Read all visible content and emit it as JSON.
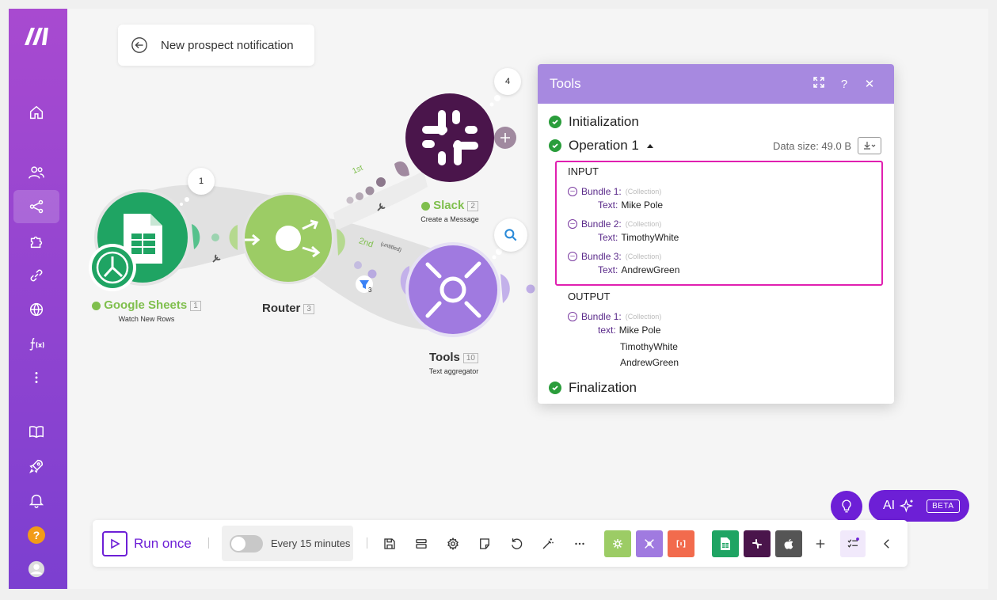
{
  "sidebar": {
    "logo": "make-logo",
    "items": [
      {
        "name": "home",
        "icon": "home-icon"
      },
      {
        "name": "team",
        "icon": "users-icon"
      },
      {
        "name": "scenarios",
        "icon": "share-icon",
        "active": true
      },
      {
        "name": "apps",
        "icon": "puzzle-icon"
      },
      {
        "name": "connections",
        "icon": "link-icon"
      },
      {
        "name": "webhooks",
        "icon": "globe-icon"
      },
      {
        "name": "functions",
        "icon": "function-icon"
      },
      {
        "name": "more",
        "icon": "more-vertical-icon"
      },
      {
        "name": "docs",
        "icon": "book-icon"
      },
      {
        "name": "whats-new",
        "icon": "rocket-icon"
      },
      {
        "name": "notifications",
        "icon": "bell-icon"
      },
      {
        "name": "help",
        "icon": "help-icon",
        "label": "?"
      },
      {
        "name": "profile",
        "icon": "avatar-icon"
      }
    ]
  },
  "scenario": {
    "title": "New prospect notification"
  },
  "modules": [
    {
      "id": "google-sheets",
      "name": "Google Sheets",
      "number": "1",
      "subtitle": "Watch New Rows",
      "ops": "1",
      "color": "#1fa463"
    },
    {
      "id": "router",
      "name": "Router",
      "number": "3",
      "color": "#9ccc65"
    },
    {
      "id": "slack",
      "name": "Slack",
      "number": "2",
      "subtitle": "Create a Message",
      "ops": "4",
      "color": "#4a154b"
    },
    {
      "id": "tools",
      "name": "Tools",
      "number": "10",
      "subtitle": "Text aggregator",
      "color": "#a07ae0"
    }
  ],
  "routes": {
    "first": "1st",
    "second": "2nd",
    "second_filter": "(untitled)",
    "filter_count": "3"
  },
  "tools_panel": {
    "title": "Tools",
    "steps": {
      "initialization": "Initialization",
      "operation": "Operation 1",
      "finalization": "Finalization"
    },
    "data_size": "Data size: 49.0 B",
    "input": {
      "title": "INPUT",
      "bundles": [
        {
          "label": "Bundle 1:",
          "type": "(Collection)",
          "key": "Text:",
          "value": "Mike Pole"
        },
        {
          "label": "Bundle 2:",
          "type": "(Collection)",
          "key": "Text:",
          "value": "TimothyWhite"
        },
        {
          "label": "Bundle 3:",
          "type": "(Collection)",
          "key": "Text:",
          "value": "AndrewGreen"
        }
      ]
    },
    "output": {
      "title": "OUTPUT",
      "bundle": {
        "label": "Bundle 1:",
        "type": "(Collection)",
        "key": "text:",
        "values": [
          "Mike Pole",
          "TimothyWhite",
          "AndrewGreen"
        ]
      }
    }
  },
  "toolbar": {
    "run_once": "Run once",
    "schedule": "Every 15 minutes",
    "accent": "#6d1fd6"
  },
  "ai": {
    "label": "AI",
    "badge": "BETA"
  }
}
